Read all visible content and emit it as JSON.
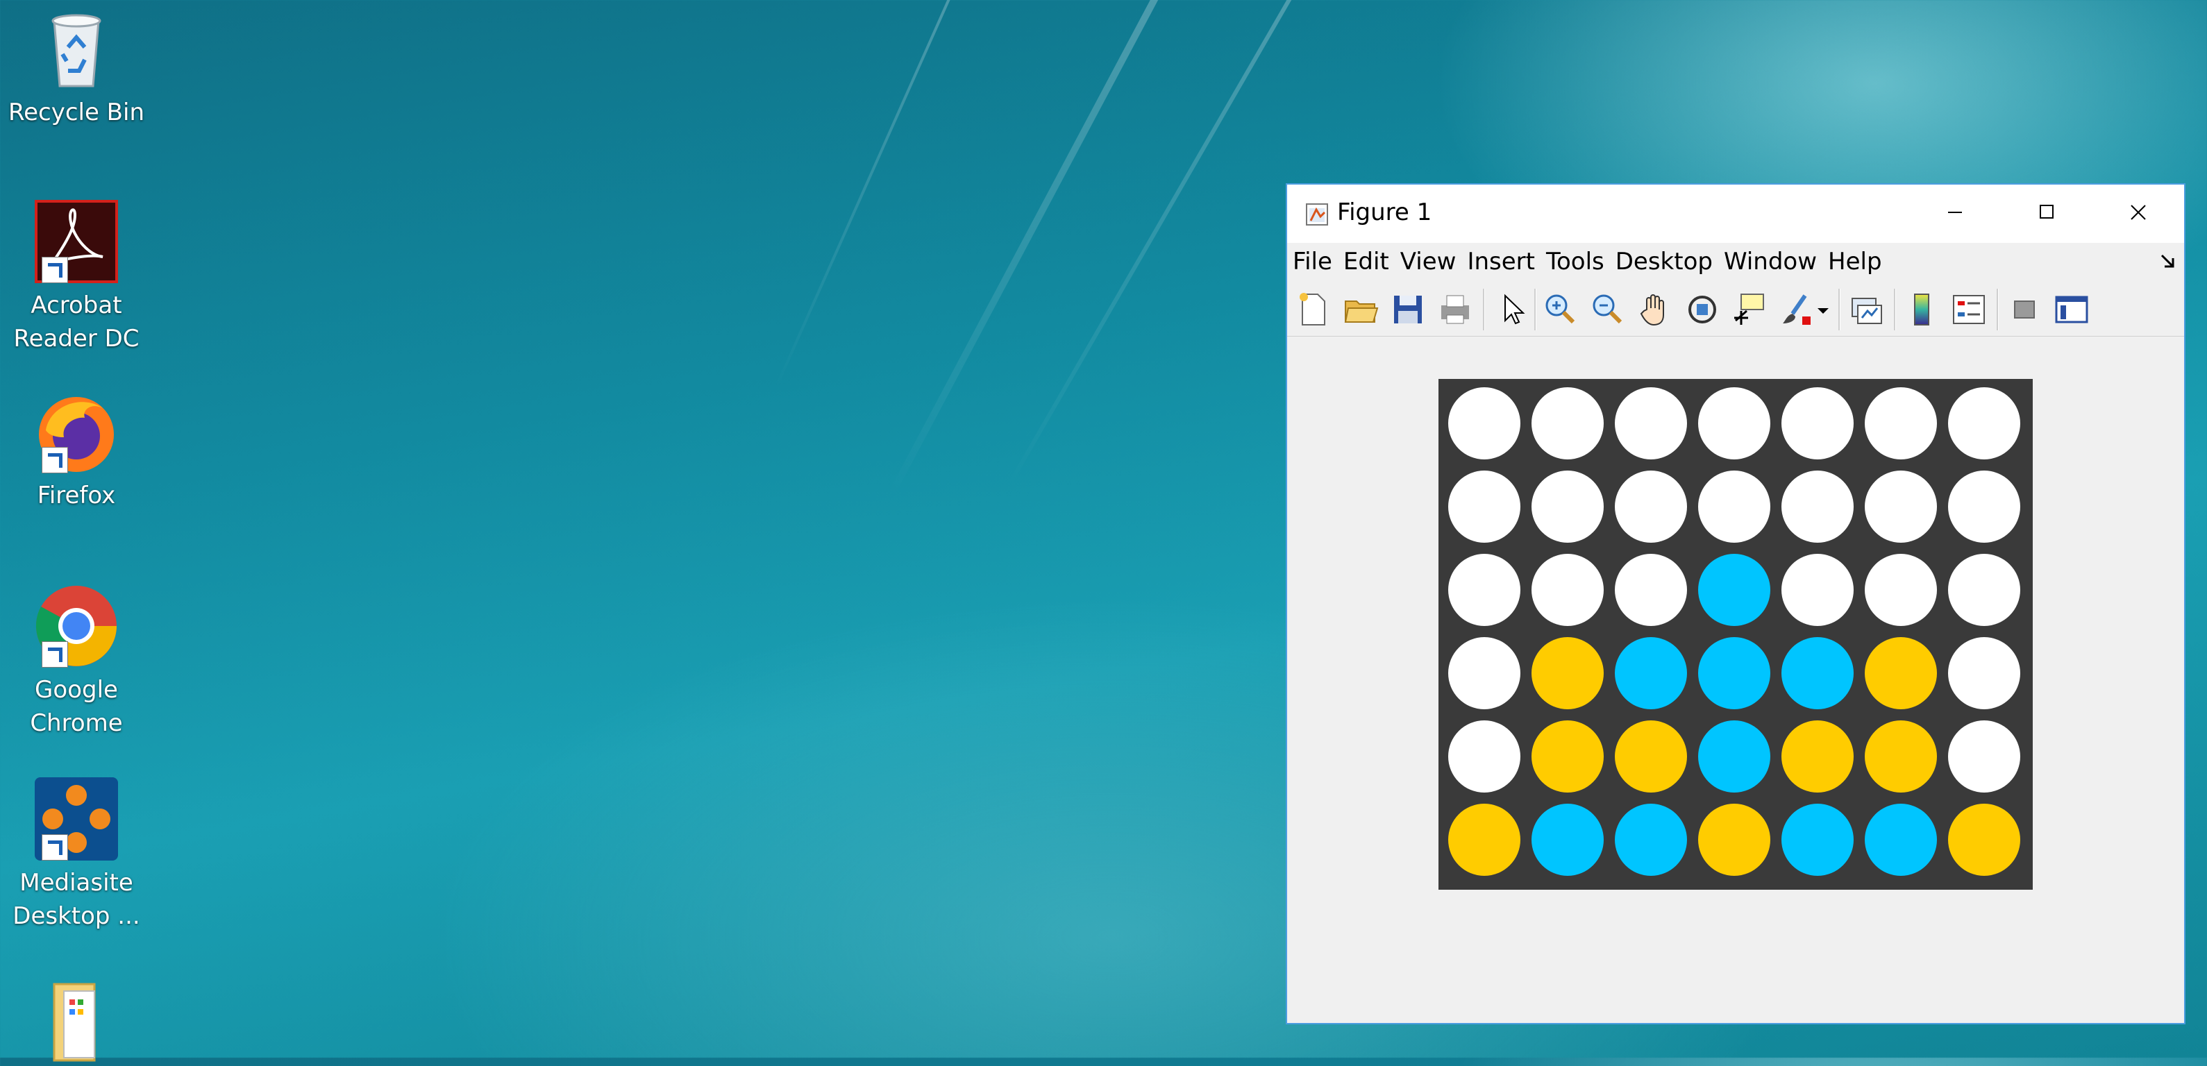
{
  "desktop": {
    "icons": [
      {
        "label": "Recycle Bin",
        "icon": "recycle-bin-icon"
      },
      {
        "label": "Acrobat Reader DC",
        "icon": "acrobat-reader-icon"
      },
      {
        "label": "Firefox",
        "icon": "firefox-icon"
      },
      {
        "label": "Google Chrome",
        "icon": "chrome-icon"
      },
      {
        "label": "Mediasite Desktop ...",
        "icon": "mediasite-icon"
      },
      {
        "label": "",
        "icon": "folder-icon"
      }
    ]
  },
  "window": {
    "title": "Figure 1",
    "app_icon": "matlab-figure-icon",
    "controls": [
      "minimize-icon",
      "maximize-icon",
      "close-icon"
    ],
    "menu": [
      "File",
      "Edit",
      "View",
      "Insert",
      "Tools",
      "Desktop",
      "Window",
      "Help"
    ],
    "toolbar": [
      "new-figure-icon",
      "open-file-icon",
      "save-icon",
      "print-icon",
      "edit-plot-arrow-icon",
      "zoom-in-icon",
      "zoom-out-icon",
      "pan-hand-icon",
      "rotate-3d-icon",
      "data-cursor-icon",
      "brush-icon",
      "link-plot-icon",
      "colorbar-icon",
      "legend-icon",
      "hide-plot-tools-icon",
      "show-plot-tools-icon"
    ]
  },
  "colors": {
    "board": "#3a3a3a",
    "empty": "#ffffff",
    "yellow": "#ffcc00",
    "blue": "#00c5ff"
  },
  "game": {
    "rows": 6,
    "cols": 7,
    "grid": [
      [
        "W",
        "W",
        "W",
        "W",
        "W",
        "W",
        "W"
      ],
      [
        "W",
        "W",
        "W",
        "W",
        "W",
        "W",
        "W"
      ],
      [
        "W",
        "W",
        "W",
        "B",
        "W",
        "W",
        "W"
      ],
      [
        "W",
        "Y",
        "B",
        "B",
        "B",
        "Y",
        "W"
      ],
      [
        "W",
        "Y",
        "Y",
        "B",
        "Y",
        "Y",
        "W"
      ],
      [
        "Y",
        "B",
        "B",
        "Y",
        "B",
        "B",
        "Y"
      ]
    ]
  }
}
